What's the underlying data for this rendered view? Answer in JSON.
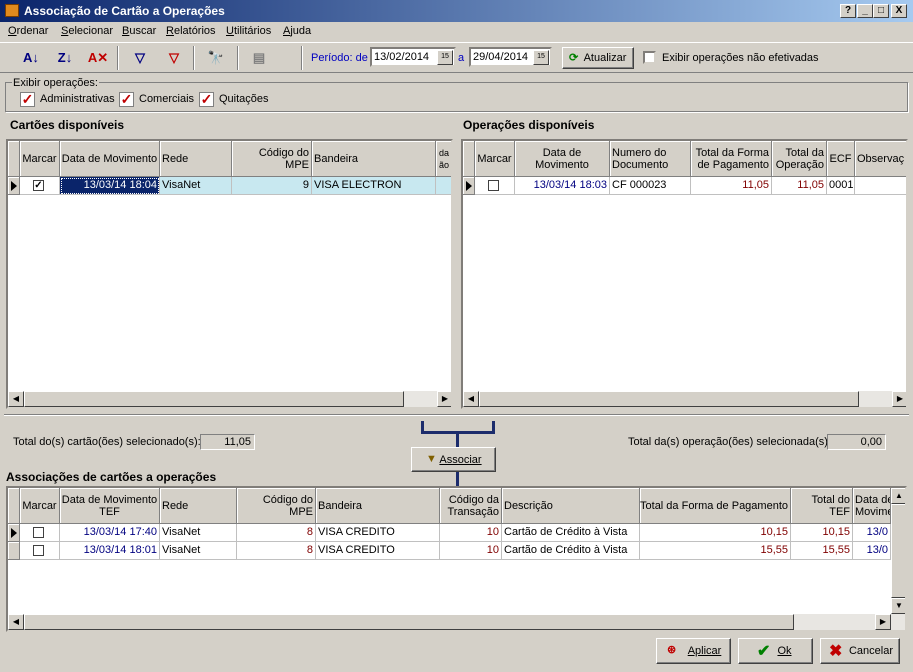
{
  "window": {
    "title": "Associação de Cartão a Operações",
    "controls": [
      "?",
      "_",
      "□",
      "X"
    ]
  },
  "menu": [
    "Ordenar",
    "Selecionar",
    "Buscar",
    "Relatórios",
    "Utilitários",
    "Ajuda"
  ],
  "toolbar": {
    "icons": [
      "sort-asc-icon",
      "sort-desc-icon",
      "clear-sort-icon",
      "filter-icon",
      "clear-filter-icon",
      "binoculars-icon",
      "disabled-icon"
    ],
    "periodo_label": "Período: de",
    "date_from": "13/02/2014",
    "a_label": "a",
    "date_to": "29/04/2014",
    "cal_label": "15",
    "atualizar_label": "Atualizar",
    "exibir_nao_efetivadas_label": "Exibir operações não efetivadas",
    "exibir_nao_efetivadas_checked": false
  },
  "exibir_operacoes": {
    "legend": "Exibir operações:",
    "options": [
      {
        "label": "Administrativas",
        "checked": true
      },
      {
        "label": "Comerciais",
        "checked": true
      },
      {
        "label": "Quitações",
        "checked": true
      }
    ]
  },
  "cartoes": {
    "title": "Cartões disponíveis",
    "headers": [
      "Marcar",
      "Data de Movimento",
      "Rede",
      "Código do MPE",
      "Bandeira",
      "da ão"
    ],
    "rows": [
      {
        "marcar": "✓",
        "data": "13/03/14 18:04",
        "rede": "VisaNet",
        "codigo": "9",
        "bandeira": "VISA ELECTRON"
      }
    ],
    "total_label": "Total do(s) cartão(ões) selecionado(s):",
    "total_value": "11,05"
  },
  "operacoes": {
    "title": "Operações disponíveis",
    "headers": [
      "Marcar",
      "Data de Movimento",
      "Numero do Documento",
      "Total da Forma de Pagamento",
      "Total da Operação",
      "ECF",
      "Observaç"
    ],
    "rows": [
      {
        "marcar": "",
        "data": "13/03/14 18:03",
        "documento": "CF 000023",
        "total_forma": "11,05",
        "total_op": "11,05",
        "ecf": "0001",
        "obs": ""
      }
    ],
    "total_label": "Total da(s) operação(ões) selecionada(s):",
    "total_value": "0,00"
  },
  "associar_label": "Associar",
  "associacoes": {
    "title": "Associações de cartões a operações",
    "headers": [
      "Marcar",
      "Data de Movimento TEF",
      "Rede",
      "Código do MPE",
      "Bandeira",
      "Código da Transação",
      "Descrição",
      "Total da Forma de Pagamento",
      "Total do TEF",
      "Data de Movimento"
    ],
    "rows": [
      {
        "marcar": "",
        "data": "13/03/14 17:40",
        "rede": "VisaNet",
        "codigo": "8",
        "bandeira": "VISA CREDITO",
        "cod_trans": "10",
        "descricao": "Cartão de Crédito à Vista",
        "total_forma": "10,15",
        "total_tef": "10,15",
        "data2": "13/0"
      },
      {
        "marcar": "",
        "data": "13/03/14 18:01",
        "rede": "VisaNet",
        "codigo": "8",
        "bandeira": "VISA CREDITO",
        "cod_trans": "10",
        "descricao": "Cartão de Crédito à Vista",
        "total_forma": "15,55",
        "total_tef": "15,55",
        "data2": "13/0"
      }
    ]
  },
  "footer": {
    "aplicar": "Aplicar",
    "ok": "Ok",
    "cancelar": "Cancelar"
  }
}
